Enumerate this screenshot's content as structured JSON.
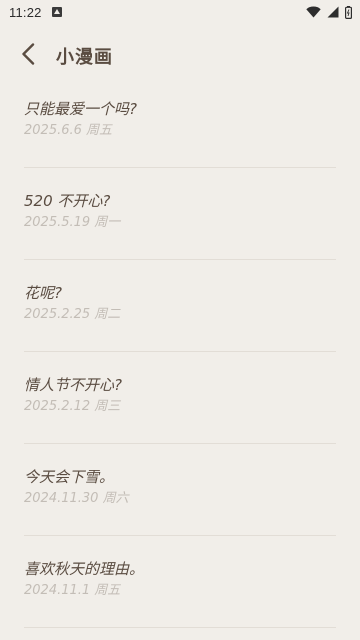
{
  "status_bar": {
    "time": "11:22",
    "icons": [
      "notification-icon",
      "wifi-icon",
      "signal-icon",
      "battery-icon"
    ]
  },
  "app_bar": {
    "back_icon": "chevron-left-icon",
    "title": "小漫画"
  },
  "colors": {
    "background": "#f1eee9",
    "title_text": "#5a4c41",
    "date_text": "#c3bdb6",
    "divider": "#e2ddd6"
  },
  "entries": [
    {
      "title": "只能最爱一个吗?",
      "date": "2025.6.6 周五"
    },
    {
      "title": "520 不开心?",
      "date": "2025.5.19 周一"
    },
    {
      "title": "花呢?",
      "date": "2025.2.25 周二"
    },
    {
      "title": "情人节不开心?",
      "date": "2025.2.12 周三"
    },
    {
      "title": "今天会下雪。",
      "date": "2024.11.30 周六"
    },
    {
      "title": "喜欢秋天的理由。",
      "date": "2024.11.1 周五"
    }
  ]
}
